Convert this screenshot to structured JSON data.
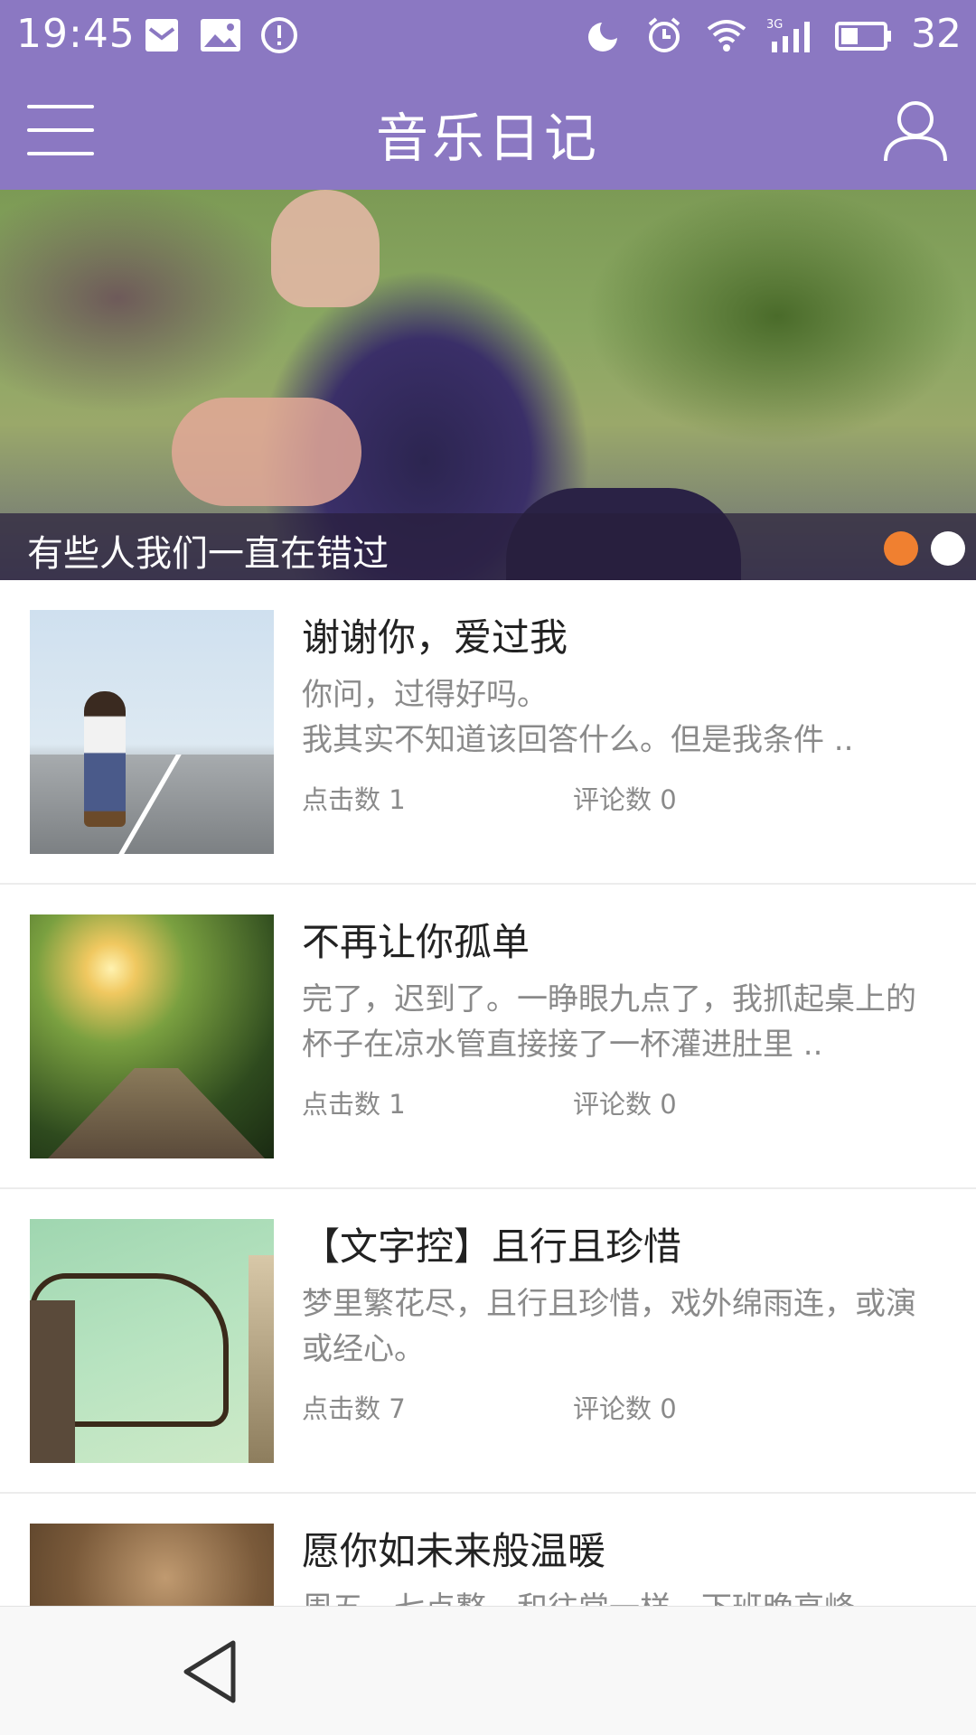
{
  "status_bar": {
    "time": "19:45",
    "battery": "32",
    "icons": [
      "mail-icon",
      "image-icon",
      "alert-icon",
      "moon-icon",
      "alarm-icon",
      "wifi-icon",
      "signal-3g-icon",
      "battery-icon"
    ]
  },
  "app_bar": {
    "title": "音乐日记",
    "left_icon": "menu-icon",
    "right_icon": "user-icon",
    "color": "#8b78c2"
  },
  "banner": {
    "caption": "有些人我们一直在错过",
    "pages": 2,
    "active_page": 1,
    "active_dot_color": "#f08030"
  },
  "diary": {
    "items": [
      {
        "title": "谢谢你，爱过我",
        "desc": "你问，过得好吗。\n我其实不知道该回答什么。但是我条件 ..",
        "clicks": "点击数 1",
        "comments": "评论数 0"
      },
      {
        "title": "不再让你孤单",
        "desc": "完了，迟到了。一睁眼九点了，我抓起桌上的杯子在凉水管直接接了一杯灌进肚里 ..",
        "clicks": "点击数 1",
        "comments": "评论数 0"
      },
      {
        "title": "【文字控】且行且珍惜",
        "desc": "梦里繁花尽，且行且珍惜，戏外绵雨连，或演或经心。",
        "clicks": "点击数 7",
        "comments": "评论数 0"
      },
      {
        "title": "愿你如未来般温暖",
        "desc": "周五，七点整，和往常一样，下班晚高峰",
        "clicks": "",
        "comments": ""
      }
    ]
  },
  "nav_bar": {
    "back_icon": "back-triangle-icon"
  }
}
